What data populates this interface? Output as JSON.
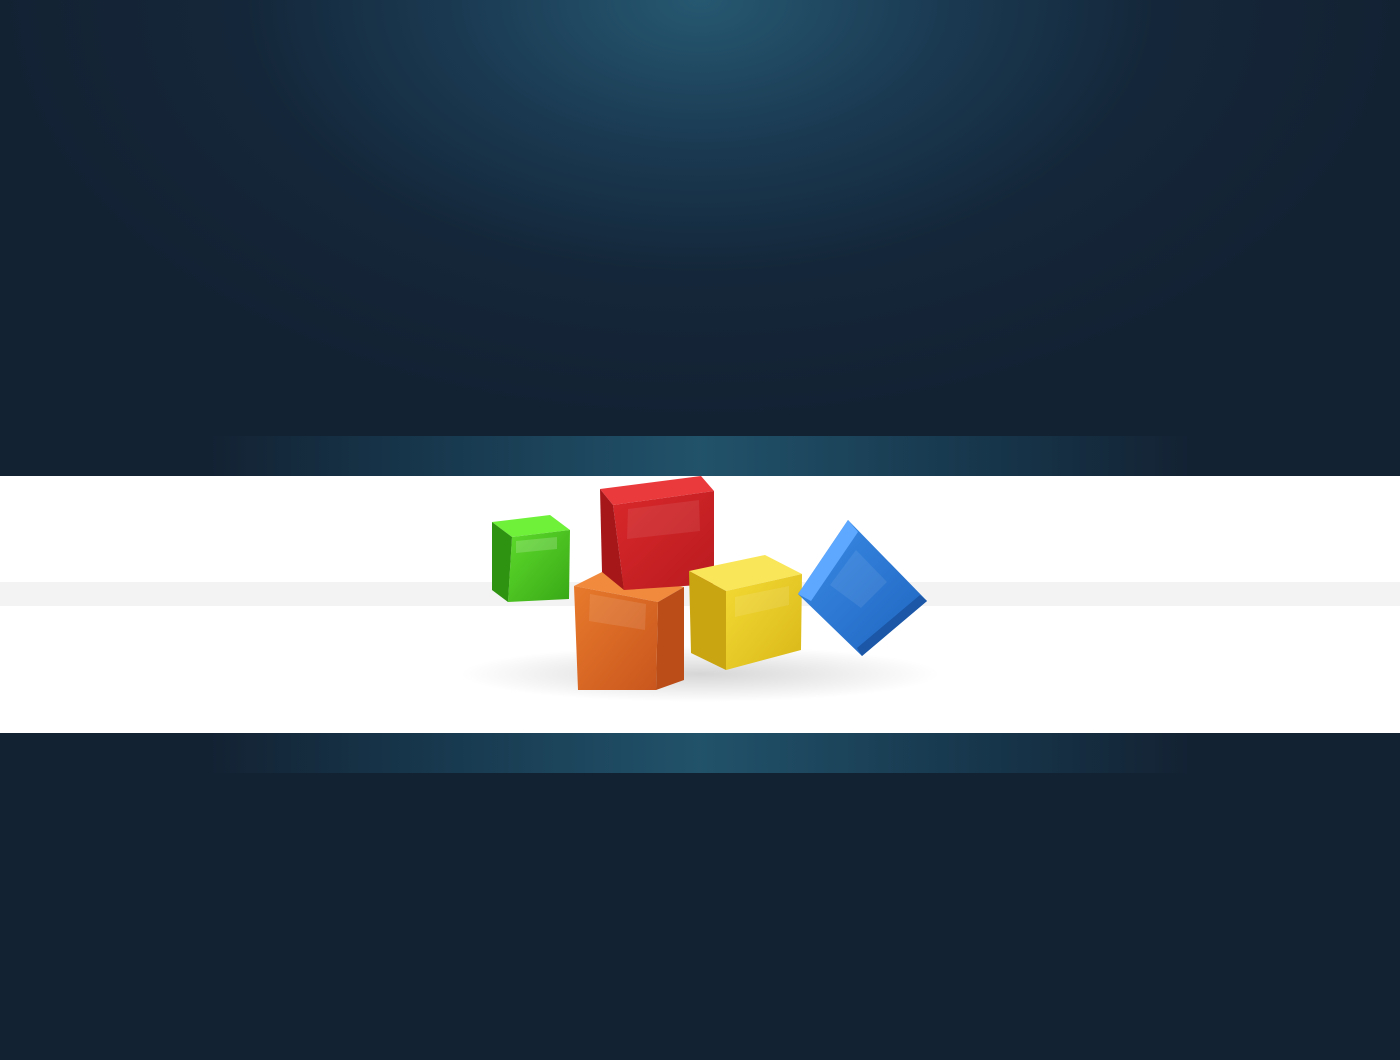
{
  "scene": {
    "background_color": "#132233",
    "glow_color": "#21536b",
    "banner_color": "#ffffff",
    "illustration": "colored-cubes"
  },
  "cubes": [
    {
      "name": "green-cube",
      "color": "#46c51a"
    },
    {
      "name": "orange-cube",
      "color": "#d76621"
    },
    {
      "name": "red-cube",
      "color": "#cc2224"
    },
    {
      "name": "yellow-cube",
      "color": "#e4c522"
    },
    {
      "name": "blue-cube",
      "color": "#2b78cf"
    }
  ]
}
